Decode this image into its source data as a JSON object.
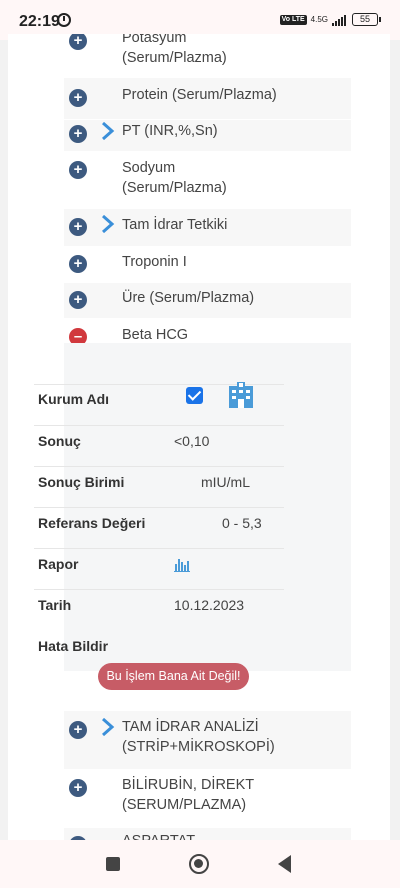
{
  "status_bar": {
    "time": "22:19",
    "volte": "Vo LTE",
    "network": "4.5G",
    "battery": "55"
  },
  "tests": [
    {
      "name": "Potasyum\n(Serum/Plazma)",
      "expanded": false,
      "has_chevron": false
    },
    {
      "name": "Protein (Serum/Plazma)",
      "expanded": false,
      "has_chevron": false
    },
    {
      "name": "PT (INR,%,Sn)",
      "expanded": false,
      "has_chevron": true
    },
    {
      "name": "Sodyum\n(Serum/Plazma)",
      "expanded": false,
      "has_chevron": false
    },
    {
      "name": "Tam İdrar Tetkiki",
      "expanded": false,
      "has_chevron": true
    },
    {
      "name": "Troponin I",
      "expanded": false,
      "has_chevron": false
    },
    {
      "name": "Üre (Serum/Plazma)",
      "expanded": false,
      "has_chevron": false
    },
    {
      "name": "Beta HCG\n(Serum/Plazma)",
      "expanded": true,
      "has_chevron": false
    },
    {
      "name": "TAM İDRAR ANALİZİ\n(STRİP+MİKROSKOPİ)",
      "expanded": false,
      "has_chevron": true
    },
    {
      "name": "BİLİRUBİN, DİREKT\n(SERUM/PLAZMA)",
      "expanded": false,
      "has_chevron": false
    },
    {
      "name": "ASPARTAT",
      "expanded": false,
      "has_chevron": false
    }
  ],
  "detail": {
    "institution_label": "Kurum Adı",
    "result_label": "Sonuç",
    "result_value": "<0,10",
    "unit_label": "Sonuç Birimi",
    "unit_value": "mIU/mL",
    "reference_label": "Referans Değeri",
    "reference_value": "0 - 5,3",
    "report_label": "Rapor",
    "date_label": "Tarih",
    "date_value": "10.12.2023",
    "report_error_label": "Hata Bildir",
    "not_mine_button": "Bu İşlem Bana Ait Değil!"
  },
  "colors": {
    "plus": "#3d5a80",
    "minus": "#d1383d",
    "chevron": "#3a8fd9",
    "checkbox": "#1a73e8",
    "error_button": "#c75c66"
  }
}
